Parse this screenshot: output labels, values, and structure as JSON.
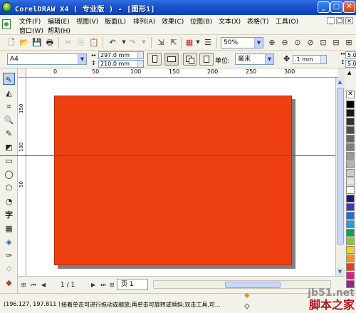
{
  "window": {
    "title": "CorelDRAW X4 ( 专业版 ) - [图形1]",
    "minimize": "_",
    "maximize": "□",
    "close": "✕"
  },
  "menu": {
    "items": [
      "文件(F)",
      "编辑(E)",
      "视图(V)",
      "版面(L)",
      "排列(A)",
      "效果(C)",
      "位图(B)",
      "文本(X)",
      "表格(T)",
      "工具(O)",
      "窗口(W)",
      "帮助(H)"
    ]
  },
  "toolbar": {
    "zoom": "50%"
  },
  "properties": {
    "paper_size": "A4",
    "width": "297.0 mm",
    "height": "210.0 mm",
    "unit_label": "单位:",
    "unit": "毫米",
    "nudge": ".1 mm",
    "dup_x": "5.0",
    "dup_y": "5.0"
  },
  "rulers": {
    "top": [
      "0",
      "50",
      "100",
      "150",
      "200",
      "250",
      "300"
    ],
    "left": [
      "150",
      "100",
      "50"
    ]
  },
  "canvas": {
    "rect_fill": "#ed3f10",
    "guideline_color": "#e5101a"
  },
  "palette": [
    "#000000",
    "#1a1a1a",
    "#333333",
    "#4d4d4d",
    "#666666",
    "#808080",
    "#999999",
    "#b3b3b3",
    "#cccccc",
    "#e6e6e6",
    "#ffffff",
    "#1c1c7a",
    "#3b3bb3",
    "#1e6fd9",
    "#1aa3e0",
    "#00a651",
    "#8cc63f",
    "#ffd200",
    "#f7941d",
    "#ed3f10",
    "#e8178a",
    "#92278f"
  ],
  "pages": {
    "counter": "1 / 1",
    "tab": "页 1"
  },
  "status": {
    "coords": "(196.127, 197.811 )",
    "message": "接着单击可进行拖动或缩放;再单击可旋转或倾斜;双击工具,可..."
  },
  "watermark": {
    "line1": "jb51.net",
    "line2": "脚本之家"
  }
}
